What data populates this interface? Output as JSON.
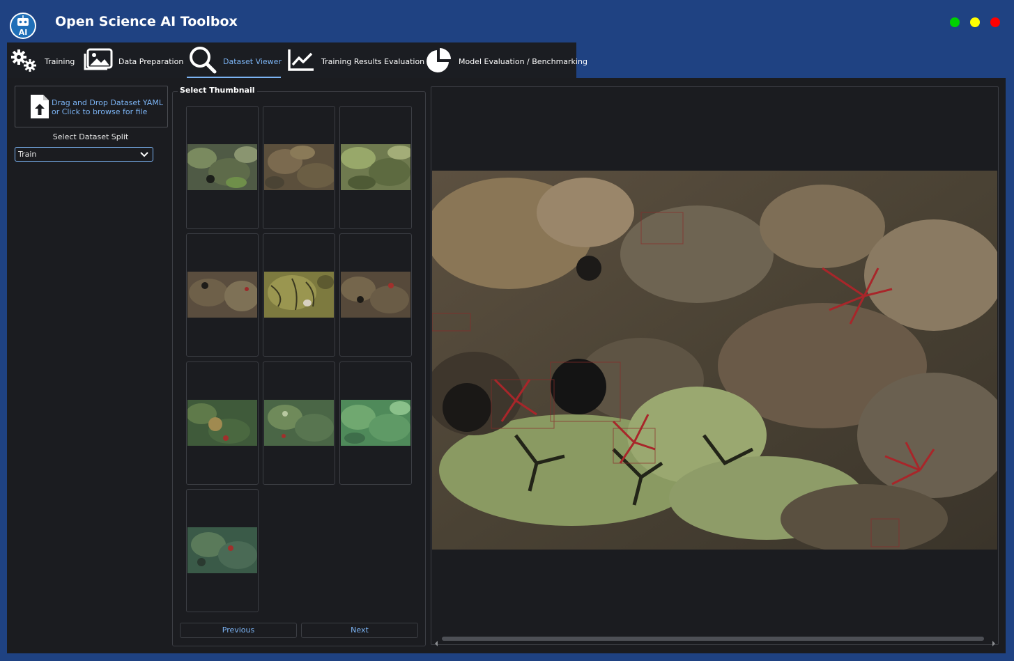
{
  "window": {
    "title": "Open Science AI Toolbox",
    "logo_text": "AI",
    "controls": {
      "green": "#00d100",
      "yellow": "#ffff00",
      "red": "#ff0000"
    }
  },
  "tabs": [
    {
      "label": "Training",
      "icon": "gears-icon",
      "active": false
    },
    {
      "label": "Data Preparation",
      "icon": "images-icon",
      "active": false
    },
    {
      "label": "Dataset Viewer",
      "icon": "search-icon",
      "active": true
    },
    {
      "label": "Training Results Evaluation",
      "icon": "line-chart-icon",
      "active": false
    },
    {
      "label": "Model Evaluation / Benchmarking",
      "icon": "pie-chart-icon",
      "active": false
    }
  ],
  "left_panel": {
    "dropzone_line1": "Drag and Drop Dataset YAML",
    "dropzone_line2": "or Click to browse for file",
    "split_label": "Select Dataset Split",
    "split_value": "Train"
  },
  "thumbnails": {
    "title": "Select Thumbnail",
    "previous_label": "Previous",
    "next_label": "Next",
    "count": 10
  },
  "colors": {
    "window_bg": "#1f4282",
    "panel_bg": "#1b1c20",
    "accent": "#7cb4f4"
  }
}
